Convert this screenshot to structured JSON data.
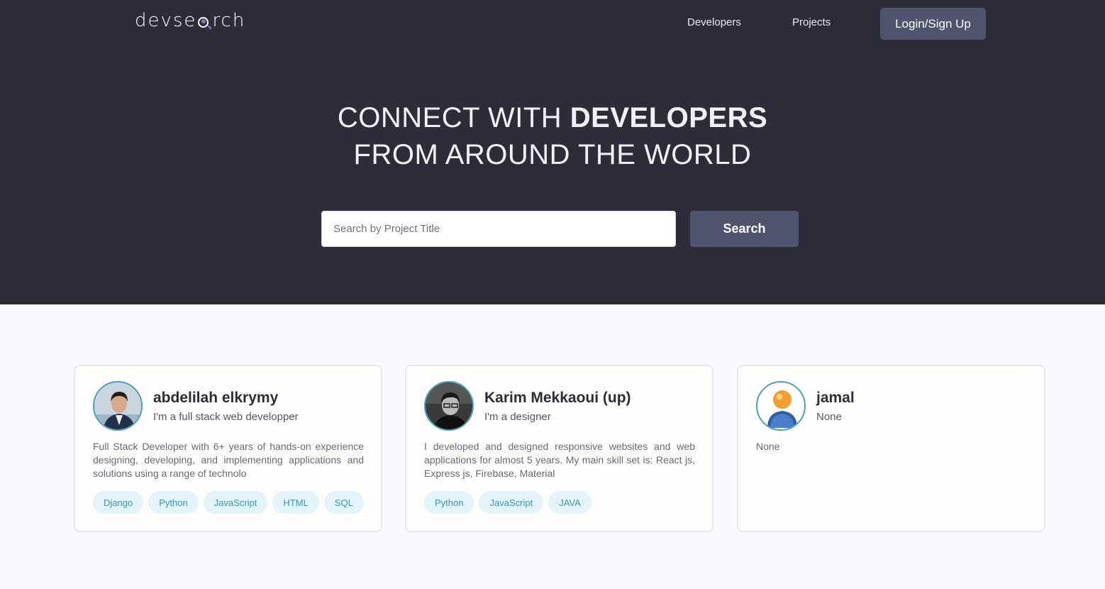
{
  "nav": {
    "logo_text_before": "devse",
    "logo_text_after": "rch",
    "links": [
      "Developers",
      "Projects"
    ],
    "login_label": "Login/Sign Up"
  },
  "hero": {
    "line1_light": "CONNECT WITH ",
    "line1_bold": "DEVELOPERS",
    "line2": "FROM AROUND THE WORLD"
  },
  "search": {
    "placeholder": "Search by Project Title",
    "value": "",
    "button_label": "Search"
  },
  "colors": {
    "hero_bg": "#2d2d39",
    "button_bg": "#51546e",
    "page_bg": "#f8fafd",
    "tag_bg": "#e3f4fa",
    "tag_text": "#3a93b4",
    "avatar_ring": "#4a9fb5"
  },
  "developers": [
    {
      "name": "abdelilah elkrymy",
      "title": "I'm a full stack web developper",
      "bio": "Full Stack Developer with 6+ years of hands-on experience designing, developing, and implementing applications and solutions using a range of technolo",
      "skills": [
        "Django",
        "Python",
        "JavaScript",
        "HTML",
        "SQL"
      ],
      "avatar": "photo-person-icon"
    },
    {
      "name": "Karim Mekkaoui (up)",
      "title": "I'm a designer",
      "bio": "I developed and designed responsive websites and web applications for almost 5 years. My main skill set is: React js, Express js, Firebase, Material",
      "skills": [
        "Python",
        "JavaScript",
        "JAVA"
      ],
      "avatar": "photo-person-bw-icon"
    },
    {
      "name": "jamal",
      "title": "None",
      "bio": "None",
      "skills": [],
      "avatar": "default-user-icon"
    }
  ]
}
